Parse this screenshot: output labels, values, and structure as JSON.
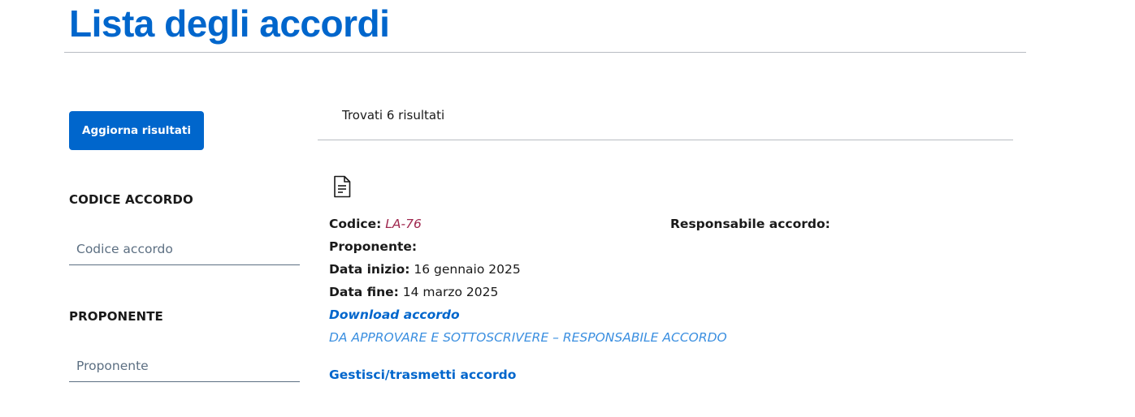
{
  "page": {
    "title": "Lista degli accordi"
  },
  "sidebar": {
    "refresh_button": "Aggiorna risultati",
    "filters": [
      {
        "label": "CODICE ACCORDO",
        "placeholder": "Codice accordo",
        "value": ""
      },
      {
        "label": "PROPONENTE",
        "placeholder": "Proponente",
        "value": ""
      }
    ]
  },
  "results": {
    "count_text": "Trovati 6 risultati",
    "items": [
      {
        "icon": "document-icon",
        "code_label": "Codice:",
        "code_value": "LA-76",
        "responsible_label": "Responsabile accordo:",
        "proponent_label": "Proponente:",
        "start_label": "Data inizio:",
        "start_value": "16 gennaio 2025",
        "end_label": "Data fine:",
        "end_value": "14 marzo 2025",
        "download_label": "Download accordo",
        "status": "DA APPROVARE E SOTTOSCRIVERE – RESPONSABILE ACCORDO",
        "manage_label": "Gestisci/trasmetti accordo"
      }
    ]
  },
  "colors": {
    "primary": "#0066cc",
    "status": "#3b8fe0",
    "code": "#a0284f",
    "divider": "#b8bcc2"
  }
}
